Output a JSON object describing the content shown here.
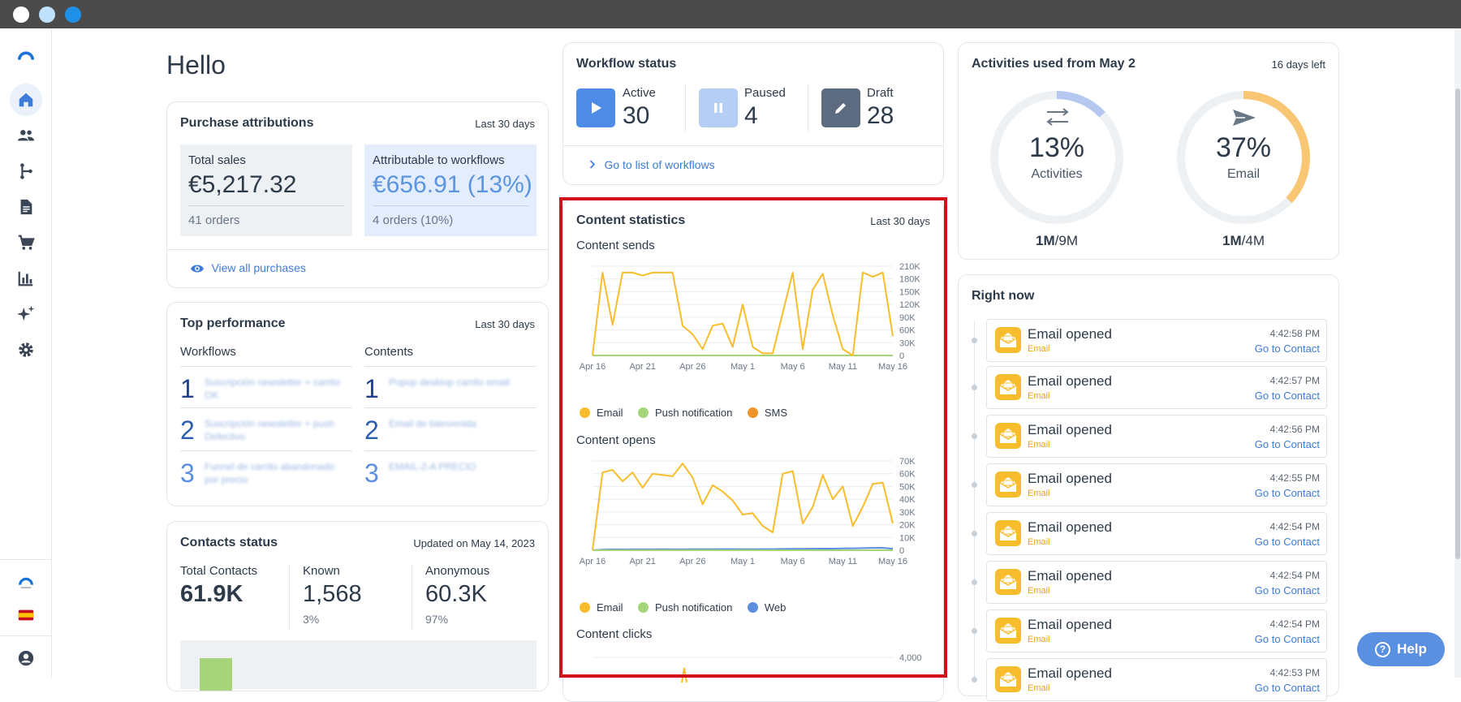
{
  "window": {
    "traffic_colors": [
      "#ffffff",
      "#bfe1fb",
      "#1e90e8"
    ]
  },
  "greeting": "Hello",
  "purchase": {
    "title": "Purchase attributions",
    "period": "Last 30 days",
    "total_label": "Total sales",
    "total_value": "€5,217.32",
    "total_orders": "41 orders",
    "attr_label": "Attributable to workflows",
    "attr_value": "€656.91 (13%)",
    "attr_orders": "4 orders (10%)",
    "view_all": "View all purchases"
  },
  "top_performance": {
    "title": "Top performance",
    "period": "Last 30 days",
    "workflows_label": "Workflows",
    "contents_label": "Contents",
    "workflows": [
      {
        "rank": "1",
        "name": "Suscripción newsletter + carrito OK"
      },
      {
        "rank": "2",
        "name": "Suscripción newsletter + push Defectivo"
      },
      {
        "rank": "3",
        "name": "Funnel de carrito abandonado por precio"
      }
    ],
    "contents": [
      {
        "rank": "1",
        "name": "Popup desktop carrito email"
      },
      {
        "rank": "2",
        "name": "Email de bienvenida"
      },
      {
        "rank": "3",
        "name": "EMAIL-2-A PRECIO"
      }
    ]
  },
  "contacts": {
    "title": "Contacts status",
    "updated": "Updated on May 14, 2023",
    "total_label": "Total Contacts",
    "total_value": "61.9K",
    "known_label": "Known",
    "known_value": "1,568",
    "known_pct": "3%",
    "anon_label": "Anonymous",
    "anon_value": "60.3K",
    "anon_pct": "97%"
  },
  "workflow_status": {
    "title": "Workflow status",
    "active_label": "Active",
    "active_value": "30",
    "paused_label": "Paused",
    "paused_value": "4",
    "draft_label": "Draft",
    "draft_value": "28",
    "link": "Go to list of workflows"
  },
  "content_stats": {
    "title": "Content statistics",
    "period": "Last 30 days",
    "sends_label": "Content sends",
    "opens_label": "Content opens",
    "clicks_label": "Content clicks",
    "legend_sends": [
      "Email",
      "Push notification",
      "SMS"
    ],
    "legend_opens": [
      "Email",
      "Push notification",
      "Web"
    ],
    "colors": {
      "email": "#f8bd2c",
      "push": "#a5d47b",
      "sms": "#f0932a",
      "web": "#5b8fe0"
    }
  },
  "chart_data": [
    {
      "type": "line",
      "x": [
        "Apr 16",
        "Apr 17",
        "Apr 18",
        "Apr 19",
        "Apr 20",
        "Apr 21",
        "Apr 22",
        "Apr 23",
        "Apr 24",
        "Apr 25",
        "Apr 26",
        "Apr 27",
        "Apr 28",
        "Apr 29",
        "Apr 30",
        "May 1",
        "May 2",
        "May 3",
        "May 4",
        "May 5",
        "May 6",
        "May 7",
        "May 8",
        "May 9",
        "May 10",
        "May 11",
        "May 12",
        "May 13",
        "May 14",
        "May 15",
        "May 16"
      ],
      "xticks": [
        "Apr 16",
        "Apr 21",
        "Apr 26",
        "May 1",
        "May 6",
        "May 11",
        "May 16"
      ],
      "yticks": [
        "0",
        "30K",
        "60K",
        "90K",
        "120K",
        "150K",
        "180K",
        "210K"
      ],
      "ylim": [
        0,
        210000
      ],
      "series": [
        {
          "name": "Email",
          "values": [
            0,
            195000,
            72000,
            195000,
            195000,
            188000,
            195000,
            195000,
            195000,
            70000,
            50000,
            15000,
            70000,
            75000,
            20000,
            120000,
            20000,
            5000,
            5000,
            100000,
            195000,
            15000,
            155000,
            192000,
            95000,
            15000,
            0,
            195000,
            185000,
            195000,
            45000
          ]
        },
        {
          "name": "Push notification",
          "values": [
            0,
            0,
            0,
            0,
            0,
            0,
            0,
            0,
            0,
            0,
            0,
            0,
            0,
            0,
            0,
            0,
            0,
            0,
            0,
            0,
            0,
            0,
            0,
            0,
            0,
            0,
            0,
            0,
            0,
            0,
            0
          ]
        },
        {
          "name": "SMS",
          "values": [
            0,
            0,
            0,
            0,
            0,
            0,
            0,
            0,
            0,
            0,
            0,
            0,
            0,
            0,
            0,
            0,
            0,
            0,
            0,
            0,
            0,
            0,
            0,
            0,
            0,
            0,
            0,
            0,
            0,
            0,
            0
          ]
        }
      ]
    },
    {
      "type": "line",
      "x": [
        "Apr 16",
        "Apr 17",
        "Apr 18",
        "Apr 19",
        "Apr 20",
        "Apr 21",
        "Apr 22",
        "Apr 23",
        "Apr 24",
        "Apr 25",
        "Apr 26",
        "Apr 27",
        "Apr 28",
        "Apr 29",
        "Apr 30",
        "May 1",
        "May 2",
        "May 3",
        "May 4",
        "May 5",
        "May 6",
        "May 7",
        "May 8",
        "May 9",
        "May 10",
        "May 11",
        "May 12",
        "May 13",
        "May 14",
        "May 15",
        "May 16"
      ],
      "xticks": [
        "Apr 16",
        "Apr 21",
        "Apr 26",
        "May 1",
        "May 6",
        "May 11",
        "May 16"
      ],
      "yticks": [
        "0",
        "10K",
        "20K",
        "30K",
        "40K",
        "50K",
        "60K",
        "70K"
      ],
      "ylim": [
        0,
        70000
      ],
      "series": [
        {
          "name": "Email",
          "values": [
            0,
            61000,
            63000,
            54000,
            61000,
            49000,
            60000,
            59000,
            58000,
            68000,
            57000,
            36000,
            51000,
            46000,
            39000,
            28000,
            29000,
            19000,
            14000,
            60000,
            62000,
            21000,
            34000,
            59000,
            40000,
            50000,
            19000,
            34000,
            52000,
            53000,
            21000
          ]
        },
        {
          "name": "Push notification",
          "values": [
            0,
            0,
            0,
            0,
            0,
            0,
            0,
            0,
            0,
            0,
            0,
            0,
            0,
            0,
            0,
            0,
            0,
            0,
            0,
            0,
            0,
            0,
            0,
            0,
            0,
            0,
            0,
            0,
            0,
            0,
            0
          ]
        },
        {
          "name": "Web",
          "values": [
            0,
            500,
            600,
            600,
            700,
            700,
            700,
            800,
            700,
            700,
            800,
            800,
            800,
            900,
            900,
            800,
            800,
            900,
            900,
            1000,
            1100,
            1100,
            1200,
            1300,
            1300,
            1400,
            1500,
            1700,
            1800,
            1900,
            1200
          ]
        }
      ]
    },
    {
      "type": "line",
      "yticks": [
        "4,000"
      ],
      "series": []
    }
  ],
  "activities": {
    "title": "Activities used from May 2",
    "days_left": "16 days left",
    "gauges": [
      {
        "pct_text": "13%",
        "fraction": 0.13,
        "label": "Activities",
        "used": "1M",
        "total": "/9M",
        "color": "#b5c9f0"
      },
      {
        "pct_text": "37%",
        "fraction": 0.37,
        "label": "Email",
        "used": "1M",
        "total": "/4M",
        "color": "#f9c774"
      }
    ]
  },
  "right_now": {
    "title": "Right now",
    "items": [
      {
        "title": "Email opened",
        "channel": "Email",
        "time": "4:42:58 PM",
        "link": "Go to Contact"
      },
      {
        "title": "Email opened",
        "channel": "Email",
        "time": "4:42:57 PM",
        "link": "Go to Contact"
      },
      {
        "title": "Email opened",
        "channel": "Email",
        "time": "4:42:56 PM",
        "link": "Go to Contact"
      },
      {
        "title": "Email opened",
        "channel": "Email",
        "time": "4:42:55 PM",
        "link": "Go to Contact"
      },
      {
        "title": "Email opened",
        "channel": "Email",
        "time": "4:42:54 PM",
        "link": "Go to Contact"
      },
      {
        "title": "Email opened",
        "channel": "Email",
        "time": "4:42:54 PM",
        "link": "Go to Contact"
      },
      {
        "title": "Email opened",
        "channel": "Email",
        "time": "4:42:54 PM",
        "link": "Go to Contact"
      },
      {
        "title": "Email opened",
        "channel": "Email",
        "time": "4:42:53 PM",
        "link": "Go to Contact"
      }
    ]
  },
  "help_button": "Help",
  "highlight_color": "#d0131a"
}
